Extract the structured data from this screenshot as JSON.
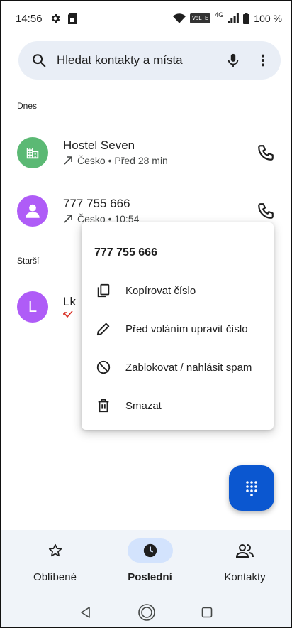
{
  "status_bar": {
    "time": "14:56",
    "network": "4G",
    "volte": "VoLTE",
    "battery": "100 %"
  },
  "search": {
    "placeholder": "Hledat kontakty a místa"
  },
  "sections": {
    "today": "Dnes",
    "older": "Starší"
  },
  "calls": [
    {
      "name": "Hostel Seven",
      "detail": "Česko • Před 28 min",
      "avatar_color": "#5bb974",
      "avatar_icon": "building-icon",
      "direction": "outgoing"
    },
    {
      "name": "777 755 666",
      "detail": "Česko • 10:54",
      "avatar_color": "#af5cf7",
      "avatar_icon": "person-icon",
      "direction": "outgoing"
    },
    {
      "name": "Lk",
      "detail": "",
      "avatar_letter": "L",
      "avatar_color": "#af5cf7",
      "direction": "missed"
    }
  ],
  "popup": {
    "title": "777 755 666",
    "items": [
      {
        "label": "Kopírovat číslo",
        "icon": "copy-icon"
      },
      {
        "label": "Před voláním upravit číslo",
        "icon": "pencil-icon"
      },
      {
        "label": "Zablokovat / nahlásit spam",
        "icon": "block-icon"
      },
      {
        "label": "Smazat",
        "icon": "trash-icon"
      }
    ]
  },
  "bottom_nav": {
    "tabs": [
      {
        "label": "Oblíbené",
        "icon": "star-icon",
        "active": false
      },
      {
        "label": "Poslední",
        "icon": "clock-icon",
        "active": true
      },
      {
        "label": "Kontakty",
        "icon": "contacts-icon",
        "active": false
      }
    ]
  },
  "colors": {
    "accent": "#0b57d0",
    "active_pill": "#d3e3fd",
    "search_bg": "#e9eef6",
    "missed": "#d93025"
  }
}
